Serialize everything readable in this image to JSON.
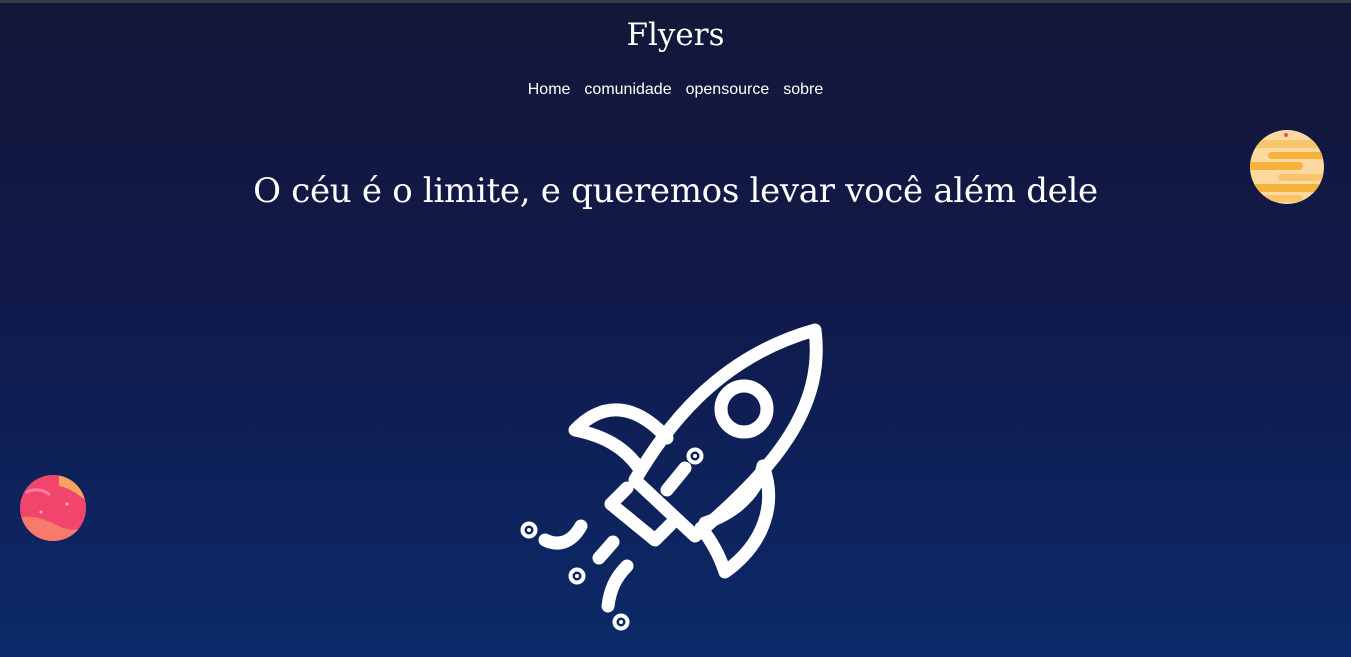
{
  "header": {
    "brand": "Flyers",
    "nav": [
      {
        "label": "Home"
      },
      {
        "label": "comunidade"
      },
      {
        "label": "opensource"
      },
      {
        "label": "sobre"
      }
    ]
  },
  "hero": {
    "headline": "O céu é o limite, e queremos levar você além dele",
    "illustration": "rocket-icon"
  },
  "decorations": {
    "planet_right": "yellow-planet-icon",
    "planet_left": "pink-planet-icon"
  },
  "colors": {
    "background_top": "#131838",
    "background_bottom": "#0c2a6a",
    "text": "#ffffff",
    "planet_yellow": "#f6b33c",
    "planet_pink": "#f2456e"
  }
}
